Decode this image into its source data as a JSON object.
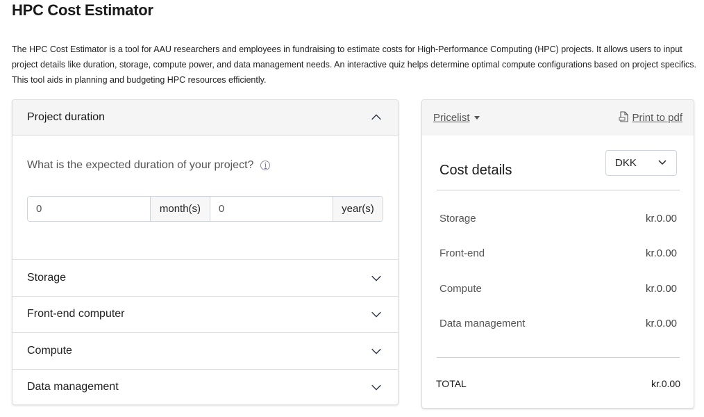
{
  "page": {
    "title": "HPC Cost Estimator",
    "intro": "The HPC Cost Estimator is a tool for AAU researchers and employees in fundraising to estimate costs for High-Performance Computing (HPC) projects. It allows users to input project details like duration, storage, compute power, and data management needs. An interactive quiz helps determine optimal compute configurations based on project specifics. This tool aids in planning and budgeting HPC resources efficiently."
  },
  "accordion": {
    "duration": {
      "title": "Project duration",
      "question": "What is the expected duration of your project?",
      "info_icon": "i",
      "months_value": "0",
      "months_unit": "month(s)",
      "years_value": "0",
      "years_unit": "year(s)"
    },
    "items": [
      {
        "label": "Storage"
      },
      {
        "label": "Front-end computer"
      },
      {
        "label": "Compute"
      },
      {
        "label": "Data management"
      }
    ]
  },
  "cost_panel": {
    "pricelist_label": "Pricelist",
    "print_label": "Print to pdf",
    "heading": "Cost details",
    "currency": "DKK",
    "rows": [
      {
        "label": "Storage",
        "amount": "kr.0.00"
      },
      {
        "label": "Front-end",
        "amount": "kr.0.00"
      },
      {
        "label": "Compute",
        "amount": "kr.0.00"
      },
      {
        "label": "Data management",
        "amount": "kr.0.00"
      }
    ],
    "total_label": "TOTAL",
    "total_amount": "kr.0.00"
  }
}
